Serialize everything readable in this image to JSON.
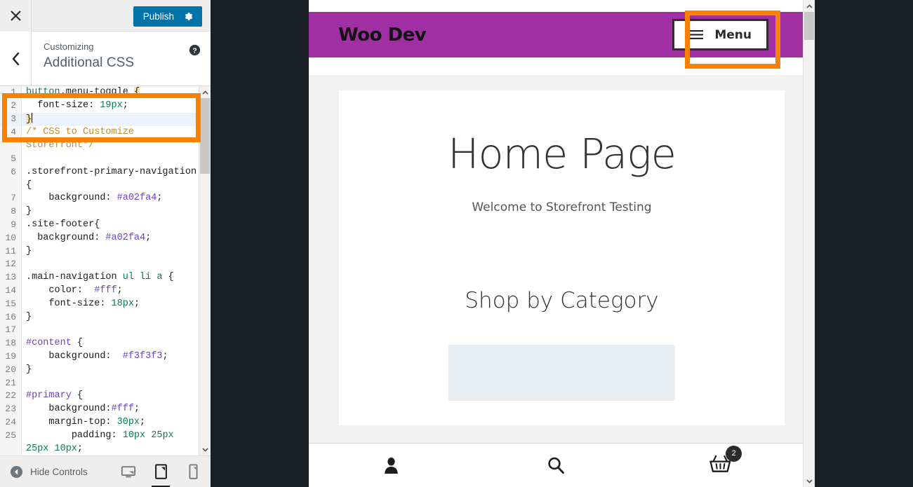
{
  "customizer": {
    "topbar": {
      "close_icon": "close-icon",
      "publish_label": "Publish",
      "gear_icon": "gear-icon"
    },
    "section": {
      "back_icon": "chevron-left-icon",
      "eyebrow": "Customizing",
      "title": "Additional CSS",
      "help_icon": "help-icon"
    },
    "editor": {
      "lines": [
        {
          "num": "1",
          "html": "<span class=\"tok-tag\">button</span><span class=\"tok-sel\">.menu-toggle </span><span class=\"tok-brace-hl\">{</span>",
          "text": "button.menu-toggle {",
          "highlight": false
        },
        {
          "num": "2",
          "html": "<span class=\"tok-prop\">  font-size: </span><span class=\"tok-val\">19px</span><span class=\"tok-prop\">;</span>",
          "text": "  font-size: 19px;",
          "highlight": false
        },
        {
          "num": "3",
          "html": "<span class=\"tok-brace-hl\">}</span><span class=\"caret\"></span>",
          "text": "}",
          "highlight": true
        },
        {
          "num": "4",
          "html": "<span class=\"tok-comment\">/* CSS to Customize Storefront*/</span>",
          "text": "/* CSS to Customize Storefront*/",
          "highlight": false
        },
        {
          "num": "5",
          "html": "",
          "text": "",
          "highlight": false
        },
        {
          "num": "6",
          "html": "<span class=\"tok-sel\">.storefront-primary-navigation {</span>",
          "text": ".storefront-primary-navigation {",
          "highlight": false
        },
        {
          "num": "7",
          "html": "<span class=\"tok-prop\">    background: </span><span class=\"tok-hash\">#a02fa4</span><span class=\"tok-prop\">;</span>",
          "text": "    background: #a02fa4;",
          "highlight": false
        },
        {
          "num": "8",
          "html": "<span class=\"tok-prop\">}</span>",
          "text": "}",
          "highlight": false
        },
        {
          "num": "9",
          "html": "<span class=\"tok-sel\">.site-footer{</span>",
          "text": ".site-footer{",
          "highlight": false
        },
        {
          "num": "10",
          "html": "<span class=\"tok-prop\">  background: </span><span class=\"tok-hash\">#a02fa4</span><span class=\"tok-prop\">;</span>",
          "text": "  background: #a02fa4;",
          "highlight": false
        },
        {
          "num": "11",
          "html": "<span class=\"tok-prop\">}</span>",
          "text": "}",
          "highlight": false
        },
        {
          "num": "12",
          "html": "",
          "text": "",
          "highlight": false
        },
        {
          "num": "13",
          "html": "<span class=\"tok-sel\">.main-navigation </span><span class=\"tok-tag\">ul li a</span><span class=\"tok-sel\"> {</span>",
          "text": ".main-navigation ul li a {",
          "highlight": false
        },
        {
          "num": "14",
          "html": "<span class=\"tok-prop\">    color:  </span><span class=\"tok-hash\">#fff</span><span class=\"tok-prop\">;</span>",
          "text": "    color:  #fff;",
          "highlight": false
        },
        {
          "num": "15",
          "html": "<span class=\"tok-prop\">    font-size: </span><span class=\"tok-val\">18px</span><span class=\"tok-prop\">;</span>",
          "text": "    font-size: 18px;",
          "highlight": false
        },
        {
          "num": "16",
          "html": "<span class=\"tok-prop\">}</span>",
          "text": "}",
          "highlight": false
        },
        {
          "num": "17",
          "html": "",
          "text": "",
          "highlight": false
        },
        {
          "num": "18",
          "html": "<span class=\"tok-id\">#content</span><span class=\"tok-sel\"> {</span>",
          "text": "#content {",
          "highlight": false
        },
        {
          "num": "19",
          "html": "<span class=\"tok-prop\">    background:  </span><span class=\"tok-hash\">#f3f3f3</span><span class=\"tok-prop\">;</span>",
          "text": "    background:  #f3f3f3;",
          "highlight": false
        },
        {
          "num": "20",
          "html": "<span class=\"tok-prop\">}</span>",
          "text": "}",
          "highlight": false
        },
        {
          "num": "21",
          "html": "",
          "text": "",
          "highlight": false
        },
        {
          "num": "22",
          "html": "<span class=\"tok-id\">#primary</span><span class=\"tok-sel\"> {</span>",
          "text": "#primary {",
          "highlight": false
        },
        {
          "num": "23",
          "html": "<span class=\"tok-prop\">    background:</span><span class=\"tok-hash\">#fff</span><span class=\"tok-prop\">;</span>",
          "text": "    background:#fff;",
          "highlight": false
        },
        {
          "num": "24",
          "html": "<span class=\"tok-prop\">    margin-top: </span><span class=\"tok-val\">30px</span><span class=\"tok-prop\">;</span>",
          "text": "    margin-top: 30px;",
          "highlight": false
        },
        {
          "num": "25",
          "html": "<span class=\"tok-prop\">        padding: </span><span class=\"tok-val\">10px 25px 25px 10px</span><span class=\"tok-prop\">;</span>",
          "text": "        padding: 10px 25px 25px 10px;",
          "highlight": false
        }
      ]
    },
    "bottom": {
      "hide_controls_label": "Hide Controls",
      "hide_icon": "collapse-left-icon",
      "devices": [
        {
          "name": "desktop-preview",
          "icon": "desktop-icon",
          "active": false
        },
        {
          "name": "tablet-preview",
          "icon": "tablet-icon",
          "active": true
        },
        {
          "name": "mobile-preview",
          "icon": "mobile-icon",
          "active": false
        }
      ]
    }
  },
  "preview": {
    "site_title": "Woo Dev",
    "menu_button": {
      "label": "Menu",
      "icon": "hamburger-icon"
    },
    "heading": "Home Page",
    "subheading": "Welcome to Storefront Testing",
    "section_heading": "Shop by Category",
    "bottom_nav": [
      {
        "name": "account-icon",
        "icon": "person-icon"
      },
      {
        "name": "search-icon",
        "icon": "magnifier-icon"
      },
      {
        "name": "cart-icon",
        "icon": "basket-icon",
        "badge": "2"
      }
    ]
  },
  "colors": {
    "brand_purple": "#a02fa4",
    "publish_blue": "#0073aa",
    "highlight_orange": "#f98000",
    "dark_chrome": "#1a1f23"
  }
}
